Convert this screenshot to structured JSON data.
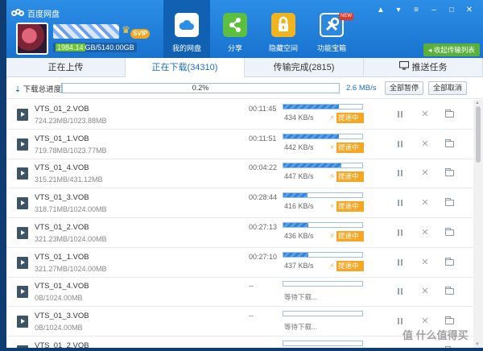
{
  "app": {
    "title": "百度网盘"
  },
  "user": {
    "vip_badge": "SVIP",
    "storage_used": "1984.14",
    "storage_rest": "GB/5140.00GB"
  },
  "nav": [
    {
      "label": "我的网盘",
      "icon": "cloud-icon"
    },
    {
      "label": "分享",
      "icon": "share-icon"
    },
    {
      "label": "隐藏空间",
      "icon": "lock-icon"
    },
    {
      "label": "功能宝箱",
      "icon": "toolbox-icon"
    }
  ],
  "nav_new_badge": "NEW",
  "window_controls": {
    "bell": "▲",
    "shirt": "▾",
    "menu": "≡",
    "minimize": "–",
    "maximize": "□",
    "close": "✕"
  },
  "collapse_button": "收起传输列表",
  "tabs": [
    {
      "label": "正在上传"
    },
    {
      "label": "正在下载(34310)"
    },
    {
      "label": "传输完成(2815)"
    },
    {
      "label": "推送任务"
    }
  ],
  "overall": {
    "label": "下载总进度",
    "percent_text": "0.2%",
    "percent": 0.2,
    "speed": "2.6 MB/s",
    "pause_all": "全部暂停",
    "cancel_all": "全部取消"
  },
  "boost_label": "提速中",
  "downloads": [
    {
      "name": "VTS_01_2.VOB",
      "size": "724.23MB/1023.88MB",
      "time": "00:11:45",
      "speed": "434 KB/s",
      "progress": 70.7,
      "state": "active"
    },
    {
      "name": "VTS_01_1.VOB",
      "size": "719.78MB/1023.77MB",
      "time": "00:11:51",
      "speed": "442 KB/s",
      "progress": 70.3,
      "state": "active"
    },
    {
      "name": "VTS_01_4.VOB",
      "size": "315.21MB/431.12MB",
      "time": "00:04:22",
      "speed": "447 KB/s",
      "progress": 73.1,
      "state": "active"
    },
    {
      "name": "VTS_01_3.VOB",
      "size": "318.71MB/1024.00MB",
      "time": "00:28:44",
      "speed": "416 KB/s",
      "progress": 31.1,
      "state": "active"
    },
    {
      "name": "VTS_01_2.VOB",
      "size": "321.23MB/1024.00MB",
      "time": "00:27:13",
      "speed": "436 KB/s",
      "progress": 31.4,
      "state": "active"
    },
    {
      "name": "VTS_01_1.VOB",
      "size": "321.27MB/1024.00MB",
      "time": "00:27:10",
      "speed": "437 KB/s",
      "progress": 31.4,
      "state": "active"
    },
    {
      "name": "VTS_01_4.VOB",
      "size": "0B/1024.00MB",
      "time": "--",
      "status": "等待下载...",
      "progress": 0,
      "state": "waiting"
    },
    {
      "name": "VTS_01_3.VOB",
      "size": "0B/1024.00MB",
      "time": "--",
      "status": "等待下载...",
      "progress": 0,
      "state": "waiting"
    },
    {
      "name": "VTS_01_2.VOB",
      "size": "",
      "time": "",
      "status": "",
      "progress": 0,
      "state": "waiting"
    }
  ],
  "watermark": "值 什么值得买"
}
